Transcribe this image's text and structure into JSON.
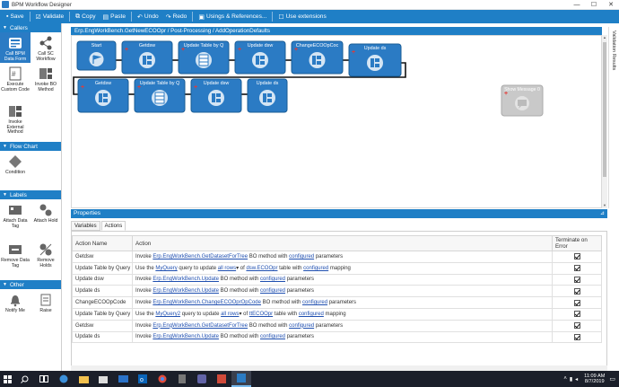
{
  "window": {
    "title": "BPM Workflow Designer",
    "minimize": "—",
    "maximize": "☐",
    "close": "✕"
  },
  "toolbar": {
    "save": "Save",
    "validate": "Validate",
    "copy": "Copy",
    "paste": "Paste",
    "undo": "Undo",
    "redo": "Redo",
    "usings": "Usings & References...",
    "extensions": "Use extensions"
  },
  "left_panel": {
    "callers": {
      "title": "Callers",
      "items": [
        {
          "label": "Call BPM Data Form",
          "icon": "form-icon",
          "selected": true
        },
        {
          "label": "Call SC Workflow",
          "icon": "workflow-icon"
        },
        {
          "label": "Execute Custom Code",
          "icon": "code-icon"
        },
        {
          "label": "Invoke BO Method",
          "icon": "method-icon"
        },
        {
          "label": "Invoke External Method",
          "icon": "external-method-icon"
        }
      ]
    },
    "flow_chart": {
      "title": "Flow Chart",
      "items": [
        {
          "label": "Condition",
          "icon": "condition-icon"
        }
      ]
    },
    "labels": {
      "title": "Labels",
      "items": [
        {
          "label": "Attach Data Tag",
          "icon": "tag-icon"
        },
        {
          "label": "Attach Hold",
          "icon": "hold-icon"
        },
        {
          "label": "Remove Data Tag",
          "icon": "remove-tag-icon"
        },
        {
          "label": "Remove Holds",
          "icon": "remove-hold-icon"
        }
      ]
    },
    "other": {
      "title": "Other",
      "items": [
        {
          "label": "Notify Me",
          "icon": "bell-icon"
        },
        {
          "label": "Raise",
          "icon": "raise-icon"
        }
      ]
    }
  },
  "canvas": {
    "path": "Erp.EngWorkBench.GetNewECOOpr / Post-Processing / AddOperationDefaults",
    "validation_tab": "Validation Results",
    "nodes_row1": [
      "Start",
      "Getdsw",
      "Update Table by Q",
      "Update dsw",
      "ChangeECOOpCoc",
      "Update ds"
    ],
    "nodes_row2": [
      "Getdsw",
      "Update Table by Q",
      "Update dsw",
      "Update ds"
    ],
    "disabled_node": "Show Message 0"
  },
  "properties": {
    "title": "Properties",
    "pin": "⊿",
    "tabs": [
      {
        "label": "Variables"
      },
      {
        "label": "Actions",
        "active": true
      }
    ],
    "columns": [
      "Action Name",
      "Action",
      "Terminate on Error"
    ],
    "rows": [
      {
        "name": "Getdsw",
        "parts": [
          [
            "Invoke ",
            ""
          ],
          [
            "Erp.EngWorkBench.GetDatasetForTree",
            "link"
          ],
          [
            " BO method with ",
            ""
          ],
          [
            "configured",
            "link"
          ],
          [
            " parameters",
            ""
          ]
        ],
        "terminate": true
      },
      {
        "name": "Update Table by Query 0",
        "parts": [
          [
            "Use the ",
            ""
          ],
          [
            "MyQuery",
            "link"
          ],
          [
            " query to update ",
            ""
          ],
          [
            "all rows",
            "link"
          ],
          [
            "▾",
            ""
          ],
          [
            " of ",
            ""
          ],
          [
            "dsw.ECOOpr",
            "link"
          ],
          [
            " table with ",
            ""
          ],
          [
            "configured",
            "link"
          ],
          [
            " mapping",
            ""
          ]
        ],
        "terminate": true
      },
      {
        "name": "Update dsw",
        "parts": [
          [
            "Invoke ",
            ""
          ],
          [
            "Erp.EngWorkBench.Update",
            "link"
          ],
          [
            " BO method with ",
            ""
          ],
          [
            "configured",
            "link"
          ],
          [
            " parameters",
            ""
          ]
        ],
        "terminate": true
      },
      {
        "name": "Update ds",
        "parts": [
          [
            "Invoke ",
            ""
          ],
          [
            "Erp.EngWorkBench.Update",
            "link"
          ],
          [
            " BO method with ",
            ""
          ],
          [
            "configured",
            "link"
          ],
          [
            " parameters",
            ""
          ]
        ],
        "terminate": true
      },
      {
        "name": "ChangeECOOpCode",
        "parts": [
          [
            "Invoke ",
            ""
          ],
          [
            "Erp.EngWorkBench.ChangeECOOprOpCode",
            "link"
          ],
          [
            " BO method with ",
            ""
          ],
          [
            "configured",
            "link"
          ],
          [
            " parameters",
            ""
          ]
        ],
        "terminate": true
      },
      {
        "name": "Update Table by Query 1",
        "parts": [
          [
            "Use the ",
            ""
          ],
          [
            "MyQuery2",
            "link"
          ],
          [
            " query to update ",
            ""
          ],
          [
            "all rows",
            "link"
          ],
          [
            "▾",
            ""
          ],
          [
            " of ",
            ""
          ],
          [
            "ttECOOpr",
            "link"
          ],
          [
            " table with ",
            ""
          ],
          [
            "configured",
            "link"
          ],
          [
            " mapping",
            ""
          ]
        ],
        "terminate": true
      },
      {
        "name": "Getdsw",
        "parts": [
          [
            "Invoke ",
            ""
          ],
          [
            "Erp.EngWorkBench.GetDatasetForTree",
            "link"
          ],
          [
            " BO method with ",
            ""
          ],
          [
            "configured",
            "link"
          ],
          [
            " parameters",
            ""
          ]
        ],
        "terminate": true
      },
      {
        "name": "Update ds",
        "parts": [
          [
            "Invoke ",
            ""
          ],
          [
            "Erp.EngWorkBench.Update",
            "link"
          ],
          [
            " BO method with ",
            ""
          ],
          [
            "configured",
            "link"
          ],
          [
            " parameters",
            ""
          ]
        ],
        "terminate": true
      }
    ]
  },
  "taskbar": {
    "clock_time": "11:09 AM",
    "clock_date": "8/7/2019",
    "apps": [
      "windows-icon",
      "search-icon",
      "task-view-icon",
      "edge-icon",
      "explorer-icon",
      "store-icon",
      "mail-icon",
      "outlook-icon",
      "chrome-icon",
      "calculator-icon",
      "teams-icon",
      "app-icon",
      "epicor-icon"
    ]
  },
  "colors": {
    "accent": "#1f7fc6",
    "node": "#2b7bc4",
    "disabled_node": "#c9c9c9",
    "link": "#1f4fb0"
  }
}
